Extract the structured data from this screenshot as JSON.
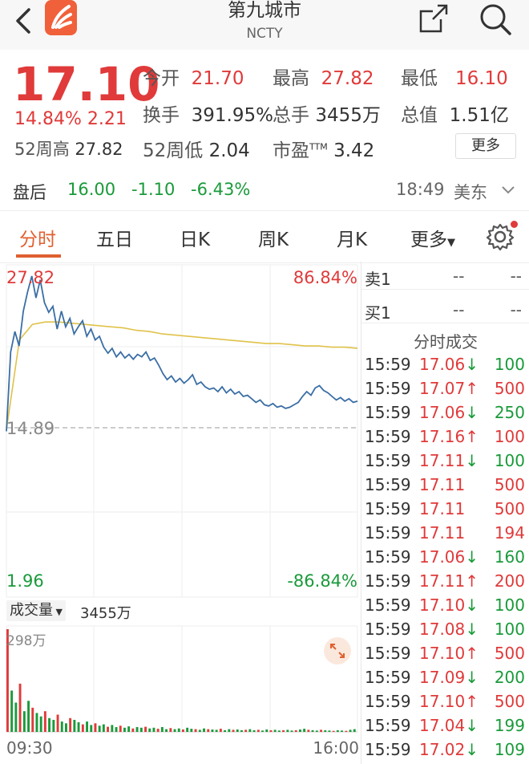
{
  "header": {
    "title": "第九城市",
    "code": "NCTY"
  },
  "quote": {
    "price": "17.10",
    "change_pct": "14.84%",
    "change_amt": "2.21",
    "fields": [
      {
        "label": "今开",
        "value": "21.70"
      },
      {
        "label": "最高",
        "value": "27.82"
      },
      {
        "label": "最低",
        "value": "16.10"
      },
      {
        "label": "换手",
        "value": "391.95%"
      },
      {
        "label": "总手",
        "value": "3455万"
      },
      {
        "label": "总值",
        "value": "1.51亿"
      },
      {
        "label": "52周高",
        "value": "27.82"
      },
      {
        "label": "52周低",
        "value": "2.04"
      },
      {
        "label": "市盈",
        "value": "3.42"
      }
    ],
    "pe_sup": "TTM",
    "more_label": "更多"
  },
  "afterhours": {
    "label": "盘后",
    "price": "16.00",
    "change": "-1.10",
    "change_pct": "-6.43%",
    "time": "18:49",
    "market": "美东"
  },
  "tabs": [
    "分时",
    "五日",
    "日K",
    "周K",
    "月K",
    "更多"
  ],
  "chart": {
    "y_top": "27.82",
    "pct_top": "86.84%",
    "y_mid": "14.89",
    "y_bottom": "1.96",
    "pct_bottom": "-86.84%",
    "volume_label": "成交量",
    "volume_value": "3455万",
    "volume_max": "298万",
    "time_start": "09:30",
    "time_end": "16:00"
  },
  "chart_data": {
    "type": "line",
    "ylim": [
      1.96,
      27.82
    ],
    "series": [
      {
        "values": [
          14.9,
          21.5,
          23.2,
          22.0,
          24.9,
          26.5,
          27.82,
          26.0,
          27.5,
          25.6,
          24.8,
          25.3,
          23.4,
          24.9,
          23.6,
          24.3,
          23.0,
          23.6,
          24.1,
          22.8,
          23.4,
          22.5,
          22.8,
          21.9,
          21.4,
          21.8,
          21.1,
          21.5,
          21.0,
          21.3,
          20.9,
          21.3,
          21.1,
          21.5,
          20.8,
          21.0,
          20.4,
          19.7,
          19.2,
          19.5,
          19.0,
          19.3,
          18.9,
          19.2,
          19.6,
          18.8,
          19.0,
          18.6,
          18.4,
          18.5,
          18.2,
          18.6,
          18.1,
          18.4,
          18.0,
          18.2,
          17.8,
          17.9,
          17.6,
          17.3,
          17.5,
          17.1,
          17.0,
          17.2,
          16.9,
          17.0,
          16.8,
          16.9,
          17.1,
          17.3,
          17.8,
          18.2,
          17.9,
          18.5,
          18.7,
          18.3,
          18.1,
          17.8,
          17.5,
          17.7,
          17.4,
          17.6,
          17.3,
          17.4
        ]
      },
      {
        "values": [
          15.0,
          22.5,
          23.8,
          24.0,
          24.0,
          23.9,
          23.8,
          23.7,
          23.6,
          23.5,
          23.3,
          23.2,
          23.0,
          22.9,
          22.8,
          22.7,
          22.6,
          22.5,
          22.4,
          22.3,
          22.2,
          22.2,
          22.1,
          22.0,
          22.0,
          21.9,
          21.9,
          21.8
        ]
      }
    ],
    "volume": [
      298,
      120,
      85,
      140,
      60,
      90,
      70,
      55,
      45,
      60,
      40,
      35,
      50,
      30,
      25,
      40,
      35,
      28,
      22,
      30,
      20,
      25,
      18,
      22,
      15,
      20,
      14,
      18,
      12,
      16,
      10,
      14,
      12,
      15,
      10,
      12,
      9,
      14,
      8,
      11,
      8,
      10,
      7,
      12,
      9,
      8,
      6,
      10,
      8,
      7,
      6,
      9,
      5,
      8,
      6,
      7,
      5,
      6,
      8,
      5,
      6,
      4,
      7,
      5,
      6,
      4,
      5,
      6,
      4,
      5,
      7,
      9,
      6,
      5,
      4,
      6,
      5,
      4,
      3,
      5,
      4,
      3,
      6,
      8
    ]
  },
  "orderbook": [
    {
      "label": "卖1",
      "price": "--",
      "vol": "--"
    },
    {
      "label": "买1",
      "price": "--",
      "vol": "--"
    }
  ],
  "trades_title": "分时成交",
  "trades": [
    {
      "time": "15:59",
      "price": "17.06",
      "dir": "↓",
      "vol": "100"
    },
    {
      "time": "15:59",
      "price": "17.07",
      "dir": "↑",
      "vol": "500"
    },
    {
      "time": "15:59",
      "price": "17.06",
      "dir": "↓",
      "vol": "250"
    },
    {
      "time": "15:59",
      "price": "17.16",
      "dir": "↑",
      "vol": "100"
    },
    {
      "time": "15:59",
      "price": "17.11",
      "dir": "↓",
      "vol": "100"
    },
    {
      "time": "15:59",
      "price": "17.11",
      "dir": "",
      "vol": "500"
    },
    {
      "time": "15:59",
      "price": "17.11",
      "dir": "",
      "vol": "500"
    },
    {
      "time": "15:59",
      "price": "17.11",
      "dir": "",
      "vol": "194"
    },
    {
      "time": "15:59",
      "price": "17.06",
      "dir": "↓",
      "vol": "160"
    },
    {
      "time": "15:59",
      "price": "17.11",
      "dir": "↑",
      "vol": "200"
    },
    {
      "time": "15:59",
      "price": "17.10",
      "dir": "↓",
      "vol": "100"
    },
    {
      "time": "15:59",
      "price": "17.08",
      "dir": "↓",
      "vol": "100"
    },
    {
      "time": "15:59",
      "price": "17.10",
      "dir": "↑",
      "vol": "500"
    },
    {
      "time": "15:59",
      "price": "17.09",
      "dir": "↓",
      "vol": "200"
    },
    {
      "time": "15:59",
      "price": "17.10",
      "dir": "↑",
      "vol": "500"
    },
    {
      "time": "15:59",
      "price": "17.04",
      "dir": "↓",
      "vol": "199"
    },
    {
      "time": "15:59",
      "price": "17.02",
      "dir": "↓",
      "vol": "109"
    }
  ],
  "colors": {
    "up": "#e03a3a",
    "down": "#1a9a3a",
    "price_line": "#3a6ea5",
    "avg_line": "#e0c24a",
    "accent": "#e06030"
  }
}
